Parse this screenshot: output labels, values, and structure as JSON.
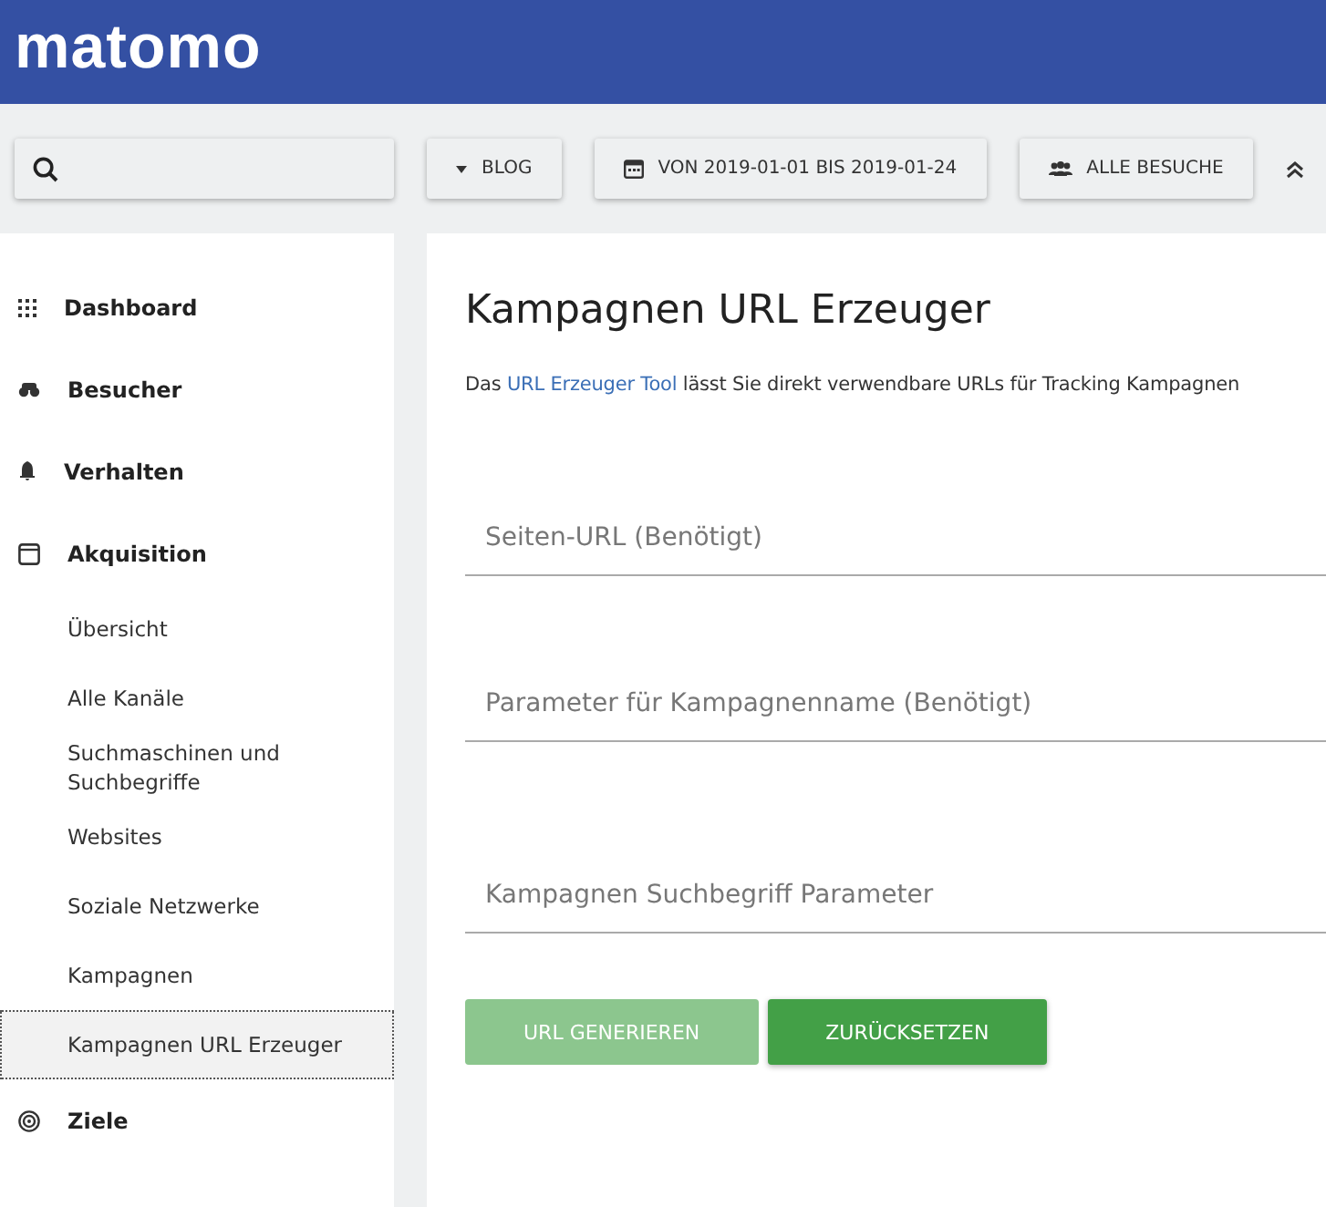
{
  "header": {
    "logo": "matomo"
  },
  "toolbar": {
    "site": "BLOG",
    "period": "VON 2019-01-01 BIS 2019-01-24",
    "segment": "ALLE BESUCHE"
  },
  "sidebar": {
    "items": [
      {
        "label": "Dashboard"
      },
      {
        "label": "Besucher"
      },
      {
        "label": "Verhalten"
      },
      {
        "label": "Akquisition",
        "children": [
          {
            "label": "Übersicht",
            "selected": false
          },
          {
            "label": "Alle Kanäle",
            "selected": false
          },
          {
            "label": "Suchmaschinen und Suchbegriffe",
            "selected": false
          },
          {
            "label": "Websites",
            "selected": false
          },
          {
            "label": "Soziale Netzwerke",
            "selected": false
          },
          {
            "label": "Kampagnen",
            "selected": false
          },
          {
            "label": "Kampagnen URL Erzeuger",
            "selected": true
          }
        ]
      },
      {
        "label": "Ziele"
      }
    ]
  },
  "content": {
    "title": "Kampagnen URL Erzeuger",
    "intro": {
      "before": "Das ",
      "link": "URL Erzeuger Tool",
      "after": " lässt Sie direkt verwendbare URLs für Tracking Kampagnen"
    },
    "fields": [
      {
        "placeholder": "Seiten-URL (Benötigt)"
      },
      {
        "placeholder": "Parameter für Kampagnenname (Benötigt)"
      },
      {
        "placeholder": "Kampagnen Suchbegriff Parameter"
      }
    ],
    "buttons": [
      {
        "label": "URL GENERIEREN",
        "disabled": true
      },
      {
        "label": "ZURÜCKSETZEN",
        "disabled": false
      }
    ]
  }
}
